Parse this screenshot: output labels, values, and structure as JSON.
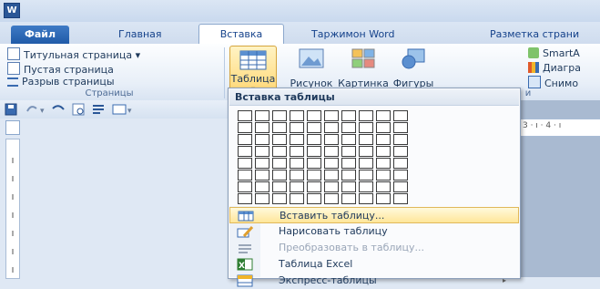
{
  "window": {
    "app_icon_letter": "W"
  },
  "tabs": [
    {
      "label": "Файл"
    },
    {
      "label": "Главная"
    },
    {
      "label": "Вставка"
    },
    {
      "label": "Таржимон Word"
    },
    {
      "label": "Разметка страни"
    }
  ],
  "ribbon": {
    "pages_group": {
      "items": [
        "Титульная страница ▾",
        "Пустая страница",
        "Разрыв страницы"
      ],
      "label": "Страницы"
    },
    "table_button": "Таблица",
    "illustrations": [
      "Рисунок",
      "Картинка",
      "Фигуры"
    ],
    "right_items": [
      "SmartA",
      "Диагра",
      "Снимо"
    ],
    "right_label": "и"
  },
  "ruler": {
    "right_text": "3 · ı · 4 · ı"
  },
  "insert_table_menu": {
    "header": "Вставка таблицы",
    "grid_cols": 10,
    "grid_rows": 8,
    "items": [
      {
        "label": "Вставить таблицу...",
        "highlighted": true,
        "disabled": false,
        "icon": "insert-table-icon"
      },
      {
        "label": "Нарисовать таблицу",
        "highlighted": false,
        "disabled": false,
        "icon": "pencil-icon"
      },
      {
        "label": "Преобразовать в таблицу...",
        "highlighted": false,
        "disabled": true,
        "icon": "convert-icon"
      },
      {
        "label": "Таблица Excel",
        "highlighted": false,
        "disabled": false,
        "icon": "excel-icon"
      },
      {
        "label": "Экспресс-таблицы",
        "highlighted": false,
        "disabled": false,
        "icon": "quick-tables-icon",
        "submenu": "▸"
      }
    ]
  },
  "colors": {
    "accent": "#2b5797",
    "file_tab": "#2f6bbd",
    "highlight": "#ffe69a"
  }
}
